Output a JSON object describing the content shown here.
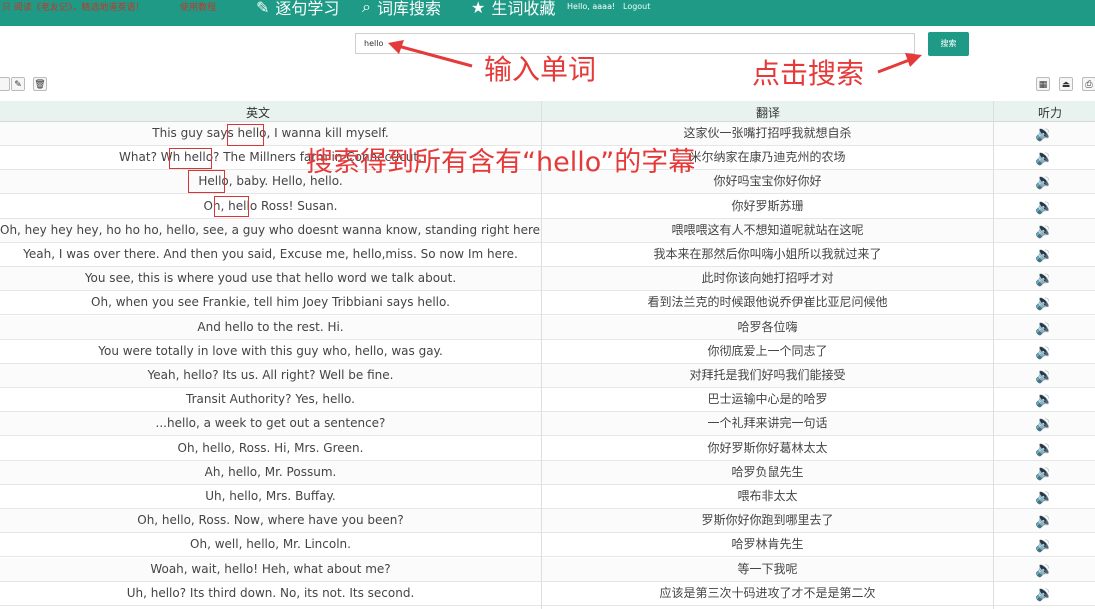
{
  "topbar": {
    "left_link1": "只 阅读《老友记》，精选地道英语！",
    "left_link2": "使用教程",
    "nav": [
      {
        "icon": "pencil-icon",
        "label": "逐句学习"
      },
      {
        "icon": "search-icon",
        "label": "词库搜索"
      },
      {
        "icon": "star-icon",
        "label": "生词收藏"
      }
    ],
    "user": "Hello, aaaa!",
    "logout": "Logout"
  },
  "search": {
    "value": "hello",
    "button": "搜索"
  },
  "table": {
    "headers": [
      "英文",
      "翻译",
      "听力"
    ],
    "rows": [
      {
        "en": "This guy says hello, I wanna kill myself.",
        "zh": "这家伙一张嘴打招呼我就想自杀"
      },
      {
        "en": "What? Wh hello? The Millners farm in Connecticut.",
        "zh": "米尔纳家在康乃迪克州的农场"
      },
      {
        "en": "Hello, baby. Hello, hello.",
        "zh": "你好吗宝宝你好你好"
      },
      {
        "en": "Oh, hello Ross! Susan.",
        "zh": "你好罗斯苏珊"
      },
      {
        "en": "Oh, hey hey hey, ho ho ho, hello, see, a guy who doesnt wanna know, standing right here!",
        "zh": "喂喂喂这有人不想知道呢就站在这呢"
      },
      {
        "en": "Yeah, I was over there. And then you said, Excuse me, hello,miss. So now Im here.",
        "zh": "我本来在那然后你叫嗨小姐所以我就过来了"
      },
      {
        "en": "You see, this is where youd use that hello word we talk about.",
        "zh": "此时你该向她打招呼才对"
      },
      {
        "en": "Oh, when you see Frankie, tell him Joey Tribbiani says hello.",
        "zh": "看到法兰克的时候跟他说乔伊崔比亚尼问候他"
      },
      {
        "en": "And hello to the rest. Hi.",
        "zh": "哈罗各位嗨"
      },
      {
        "en": "You were totally in love with this guy who, hello, was gay.",
        "zh": "你彻底爱上一个同志了"
      },
      {
        "en": "Yeah, hello? Its us. All right? Well be fine.",
        "zh": "对拜托是我们好吗我们能接受"
      },
      {
        "en": "Transit Authority? Yes, hello.",
        "zh": "巴士运输中心是的哈罗"
      },
      {
        "en": "...hello, a week to get out a sentence?",
        "zh": "一个礼拜来讲完一句话"
      },
      {
        "en": "Oh, hello, Ross. Hi, Mrs. Green.",
        "zh": "你好罗斯你好葛林太太"
      },
      {
        "en": "Ah, hello, Mr. Possum.",
        "zh": "哈罗负鼠先生"
      },
      {
        "en": "Uh, hello, Mrs. Buffay.",
        "zh": "喂布非太太"
      },
      {
        "en": "Oh, hello, Ross. Now, where have you been?",
        "zh": "罗斯你好你跑到哪里去了"
      },
      {
        "en": "Oh, well, hello, Mr. Lincoln.",
        "zh": "哈罗林肯先生"
      },
      {
        "en": "Woah, wait, hello! Heh, what about me?",
        "zh": "等一下我呢"
      },
      {
        "en": "Uh, hello? Its third down. No, its not. Its second.",
        "zh": "应该是第三次十码进攻了才不是是第二次"
      }
    ]
  },
  "annotations": {
    "input_word": "输入单词",
    "click_search": "点击搜索",
    "result_note": "搜索得到所有含有“hello”的字幕"
  },
  "colors": {
    "brand": "#1e9a86",
    "annotation": "#e53a3a",
    "speaker": "#6b6bd6"
  }
}
